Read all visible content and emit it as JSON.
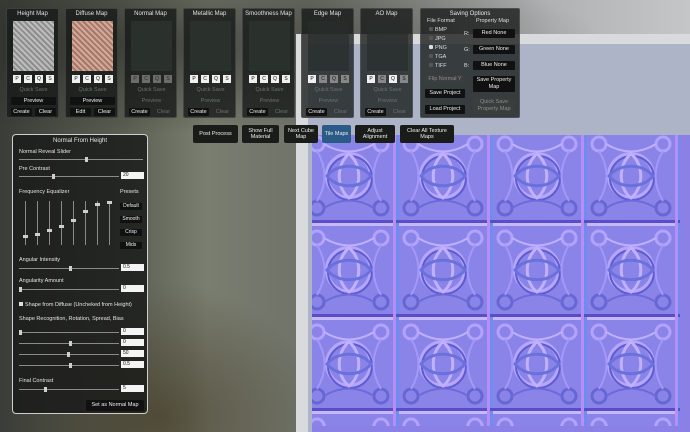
{
  "map_panels": [
    {
      "title": "Height Map",
      "pcqs": [
        "P",
        "C",
        "Q",
        "S"
      ],
      "quick_save": "Quick Save",
      "preview": "Preview",
      "create": "Create",
      "clear": "Clear"
    },
    {
      "title": "Diffuse Map",
      "pcqs": [
        "P",
        "C",
        "Q",
        "S"
      ],
      "quick_save": "Quick Save",
      "preview": "Preview",
      "create": "Edit",
      "clear": "Clear"
    },
    {
      "title": "Normal Map",
      "pcqs": [
        "P",
        "C",
        "Q",
        "S"
      ],
      "quick_save": "Quick Save",
      "preview": "Preview",
      "create": "Create",
      "clear": "Clear"
    },
    {
      "title": "Metallic Map",
      "pcqs": [
        "P",
        "C",
        "Q",
        "S"
      ],
      "quick_save": "Quick Save",
      "preview": "Preview",
      "create": "Create",
      "clear": "Clear"
    },
    {
      "title": "Smoothness Map",
      "pcqs": [
        "P",
        "C",
        "Q",
        "S"
      ],
      "quick_save": "Quick Save",
      "preview": "Preview",
      "create": "Create",
      "clear": "Clear"
    },
    {
      "title": "Edge Map",
      "pcqs": [
        "P",
        "C",
        "Q",
        "S"
      ],
      "quick_save": "Quick Save",
      "preview": "Preview",
      "create": "Create",
      "clear": "Clear"
    },
    {
      "title": "AO Map",
      "pcqs": [
        "P",
        "C",
        "Q",
        "S"
      ],
      "quick_save": "Quick Save",
      "preview": "Preview",
      "create": "Create",
      "clear": "Clear"
    }
  ],
  "saving": {
    "title": "Saving Options",
    "file_format_label": "File Format",
    "property_map_label": "Property Map",
    "formats": [
      "BMP",
      "JPG",
      "PNG",
      "TGA",
      "TIFF"
    ],
    "selected_format": "PNG",
    "channels": [
      {
        "ch": "R:",
        "value": "Red None"
      },
      {
        "ch": "G:",
        "value": "Green None"
      },
      {
        "ch": "B:",
        "value": "Blue None"
      }
    ],
    "flip_normal": "Flip Normal Y",
    "save_project": "Save Project",
    "load_project": "Load Project",
    "save_property": "Save Property Map",
    "quick_save_property": "Quick Save Property Map"
  },
  "toolbar": [
    "Post Process",
    "Show Full Material",
    "Next Cube Map",
    "Tile Maps",
    "Adjust Alignment",
    "Clear All Texture Maps"
  ],
  "nfh": {
    "title": "Normal From Height",
    "reveal": "Normal Reveal Slider",
    "pre_contrast": "Pre Contrast",
    "pre_contrast_val": "20",
    "freq_eq": "Frequency Equalizer",
    "presets_label": "Presets",
    "presets": [
      "Default",
      "Smooth",
      "Crisp",
      "Mids"
    ],
    "angular_intensity": "Angular Intensity",
    "angular_intensity_val": "0.5",
    "angularity_amount": "Angularity Amount",
    "angularity_amount_val": "0",
    "shape_from_diffuse": "Shape from Diffuse (Uncheked from Height)",
    "shape_recognition": "Shape Recognition, Rotation, Spread, Bias",
    "shape_vals": [
      "0",
      "0",
      "50",
      "0.5"
    ],
    "final_contrast": "Final Contrast",
    "final_contrast_val": "5",
    "set_normal": "Set as Normal Map"
  }
}
